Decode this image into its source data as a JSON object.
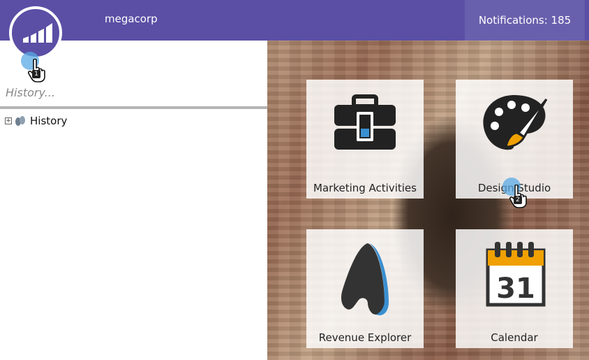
{
  "header": {
    "org_name": "megacorp",
    "notifications_label": "Notifications: 185"
  },
  "search": {
    "placeholder": "History..."
  },
  "tree": {
    "items": [
      {
        "label": "History",
        "expander": "+"
      }
    ]
  },
  "tiles": [
    {
      "label": "Marketing Activities",
      "icon": "briefcase-icon"
    },
    {
      "label": "Design Studio",
      "icon": "palette-icon"
    },
    {
      "label": "Revenue Explorer",
      "icon": "revenue-explorer-icon"
    },
    {
      "label": "Calendar",
      "icon": "calendar-icon",
      "icon_text": "31"
    }
  ],
  "cursors": [
    {
      "step": "1"
    },
    {
      "step": "2"
    }
  ],
  "colors": {
    "brand": "#5a4fa5",
    "accent_blue": "#3a8fd0",
    "accent_orange": "#f0a000"
  }
}
